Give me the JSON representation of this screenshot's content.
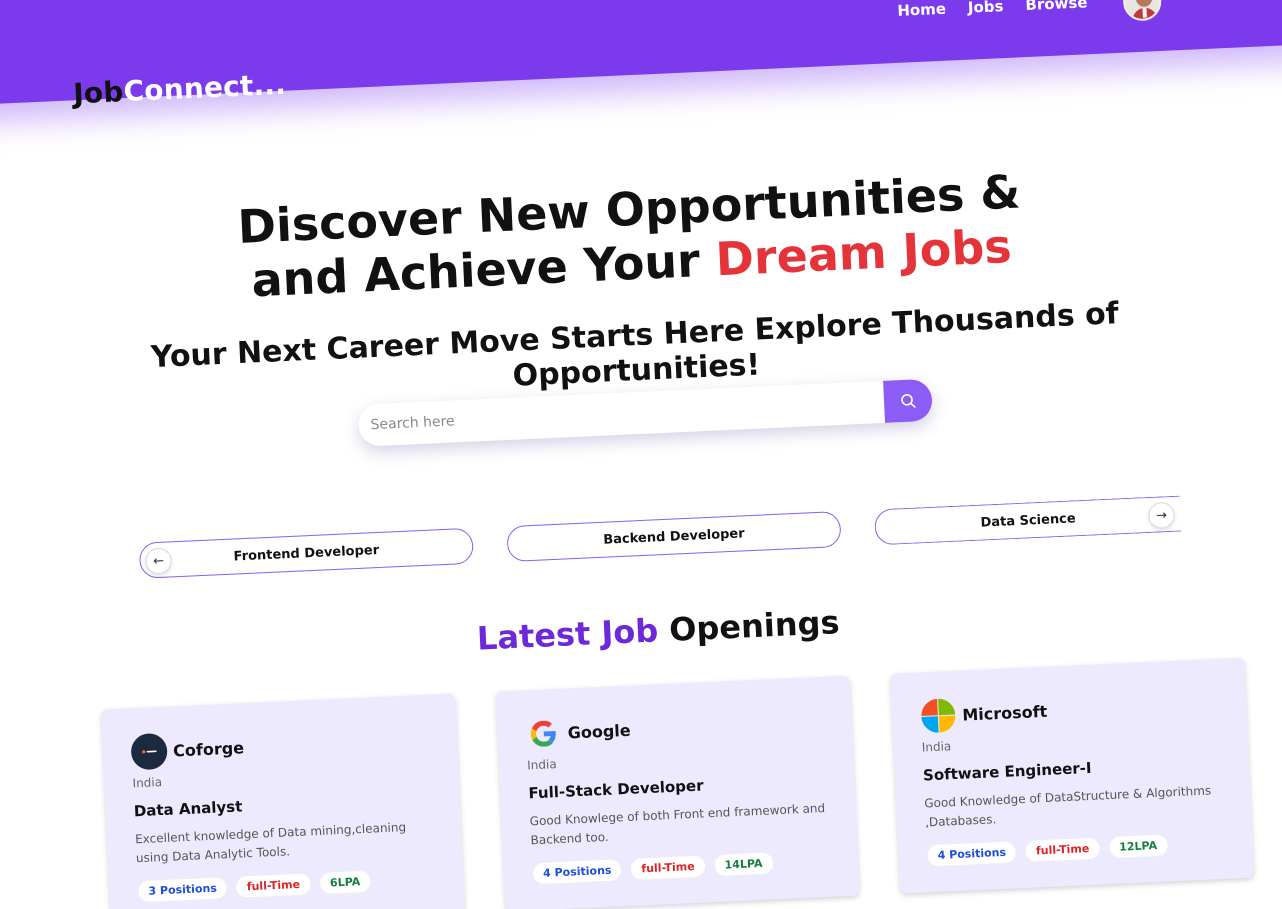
{
  "brand": {
    "logo_part1": "Job",
    "logo_part2": "Connect..."
  },
  "nav": {
    "links": [
      "Home",
      "Jobs",
      "Browse"
    ]
  },
  "hero": {
    "title_line1": "Discover New Opportunities &",
    "title_line2_prefix": "and Achieve Your ",
    "title_line2_highlight": "Dream Jobs",
    "tagline": "Your Next Career Move Starts Here Explore Thousands of Opportunities!"
  },
  "search": {
    "placeholder": "Search here",
    "value": ""
  },
  "categories": [
    "Frontend Developer",
    "Backend Developer",
    "Data Science"
  ],
  "section": {
    "title_highlight": "Latest Job",
    "title_rest": " Openings"
  },
  "jobs": [
    {
      "company": "Coforge",
      "logo_text": "Coforge",
      "location": "India",
      "title": "Data Analyst",
      "description": "Excellent knowledge of Data mining,cleaning using Data Analytic Tools.",
      "positions": "3 Positions",
      "type": "full-Time",
      "salary": "6LPA"
    },
    {
      "company": "Google",
      "logo_text": "G",
      "location": "India",
      "title": "Full-Stack Developer",
      "description": "Good Knowlege of both Front end framework and Backend too.",
      "positions": "4 Positions",
      "type": "full-Time",
      "salary": "14LPA"
    },
    {
      "company": "Microsoft",
      "logo_text": "",
      "location": "India",
      "title": "Software Engineer-I",
      "description": "Good Knowledge of DataStructure & Algorithms ,Databases.",
      "positions": "4 Positions",
      "type": "full-Time",
      "salary": "12LPA"
    }
  ],
  "colors": {
    "brand": "#7c3aed",
    "accent_red": "#e5333a",
    "card_bg": "#ede9fe"
  }
}
